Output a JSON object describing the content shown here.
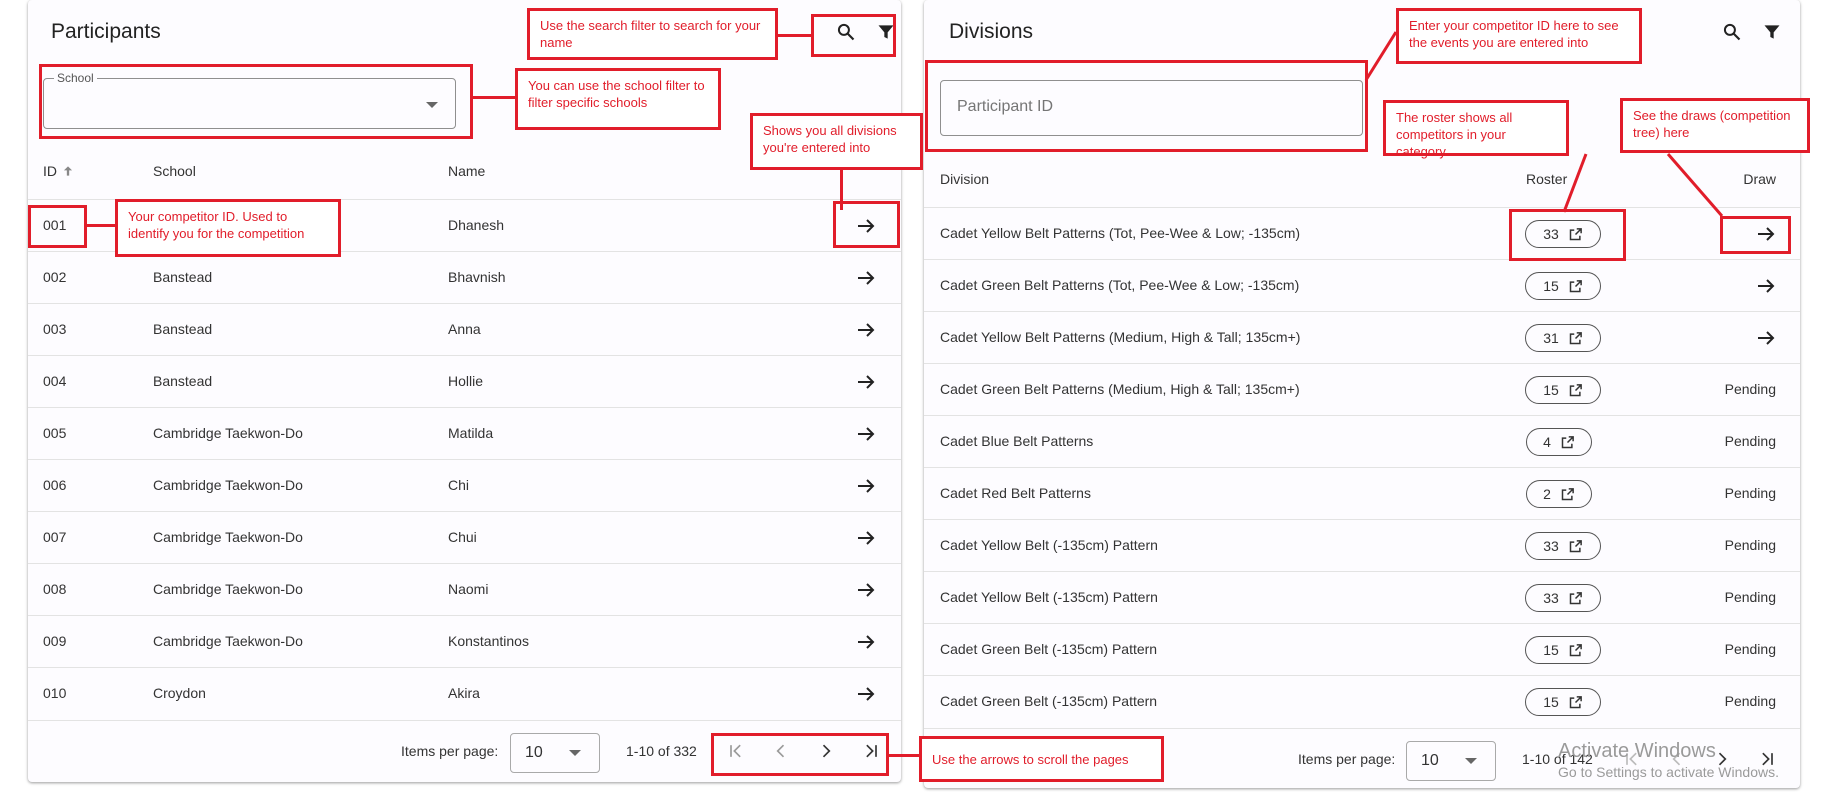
{
  "participants": {
    "title": "Participants",
    "school_filter": {
      "label": "School",
      "value": ""
    },
    "columns": {
      "id": "ID",
      "school": "School",
      "name": "Name"
    },
    "rows": [
      {
        "id": "001",
        "school": "",
        "name": "Dhanesh"
      },
      {
        "id": "002",
        "school": "Banstead",
        "name": "Bhavnish"
      },
      {
        "id": "003",
        "school": "Banstead",
        "name": "Anna"
      },
      {
        "id": "004",
        "school": "Banstead",
        "name": "Hollie"
      },
      {
        "id": "005",
        "school": "Cambridge Taekwon-Do",
        "name": "Matilda"
      },
      {
        "id": "006",
        "school": "Cambridge Taekwon-Do",
        "name": "Chi"
      },
      {
        "id": "007",
        "school": "Cambridge Taekwon-Do",
        "name": "Chui"
      },
      {
        "id": "008",
        "school": "Cambridge Taekwon-Do",
        "name": "Naomi"
      },
      {
        "id": "009",
        "school": "Cambridge Taekwon-Do",
        "name": "Konstantinos"
      },
      {
        "id": "010",
        "school": "Croydon",
        "name": "Akira"
      }
    ],
    "pager": {
      "items_label": "Items per page:",
      "per_page": "10",
      "range": "1-10 of 332"
    }
  },
  "divisions": {
    "title": "Divisions",
    "id_placeholder": "Participant ID",
    "columns": {
      "division": "Division",
      "roster": "Roster",
      "draw": "Draw"
    },
    "rows": [
      {
        "division": "Cadet Yellow Belt Patterns (Tot, Pee-Wee & Low; -135cm)",
        "roster": "33",
        "draw": ""
      },
      {
        "division": "Cadet Green Belt Patterns (Tot, Pee-Wee & Low; -135cm)",
        "roster": "15",
        "draw": ""
      },
      {
        "division": "Cadet Yellow Belt Patterns (Medium, High & Tall; 135cm+)",
        "roster": "31",
        "draw": ""
      },
      {
        "division": "Cadet Green Belt Patterns (Medium, High & Tall; 135cm+)",
        "roster": "15",
        "draw": "Pending"
      },
      {
        "division": "Cadet Blue Belt Patterns",
        "roster": "4",
        "draw": "Pending"
      },
      {
        "division": "Cadet Red Belt Patterns",
        "roster": "2",
        "draw": "Pending"
      },
      {
        "division": "Cadet Yellow Belt (-135cm) Pattern",
        "roster": "33",
        "draw": "Pending"
      },
      {
        "division": "Cadet Yellow Belt (-135cm) Pattern",
        "roster": "33",
        "draw": "Pending"
      },
      {
        "division": "Cadet Green Belt (-135cm) Pattern",
        "roster": "15",
        "draw": "Pending"
      },
      {
        "division": "Cadet Green Belt (-135cm) Pattern",
        "roster": "15",
        "draw": "Pending"
      }
    ],
    "pager": {
      "items_label": "Items per page:",
      "per_page": "10",
      "range": "1-10 of 142"
    }
  },
  "annotations": {
    "search": "Use the search filter to search for your name",
    "school": "You can use the school filter to filter specific schools",
    "divisions": "Shows you all divisions you're entered into",
    "competitor_id": "Your competitor ID. Used to identify you for the competition",
    "pages": "Use the arrows to scroll the pages",
    "enter_id": "Enter your competitor ID here to see the events you are entered into",
    "roster": "The roster shows all competitors in your category.",
    "draws": "See the draws (competition tree) here"
  },
  "watermark": {
    "title": "Activate Windows",
    "subtitle": "Go to Settings to activate Windows."
  },
  "icons": [
    "search-icon",
    "filter-icon",
    "arrow-right-icon",
    "open-in-new-icon",
    "first-page-icon",
    "chevron-left-icon",
    "chevron-right-icon",
    "last-page-icon",
    "sort-up-icon",
    "dropdown-caret-icon"
  ],
  "colors": {
    "annotation": "#e11d2a"
  }
}
